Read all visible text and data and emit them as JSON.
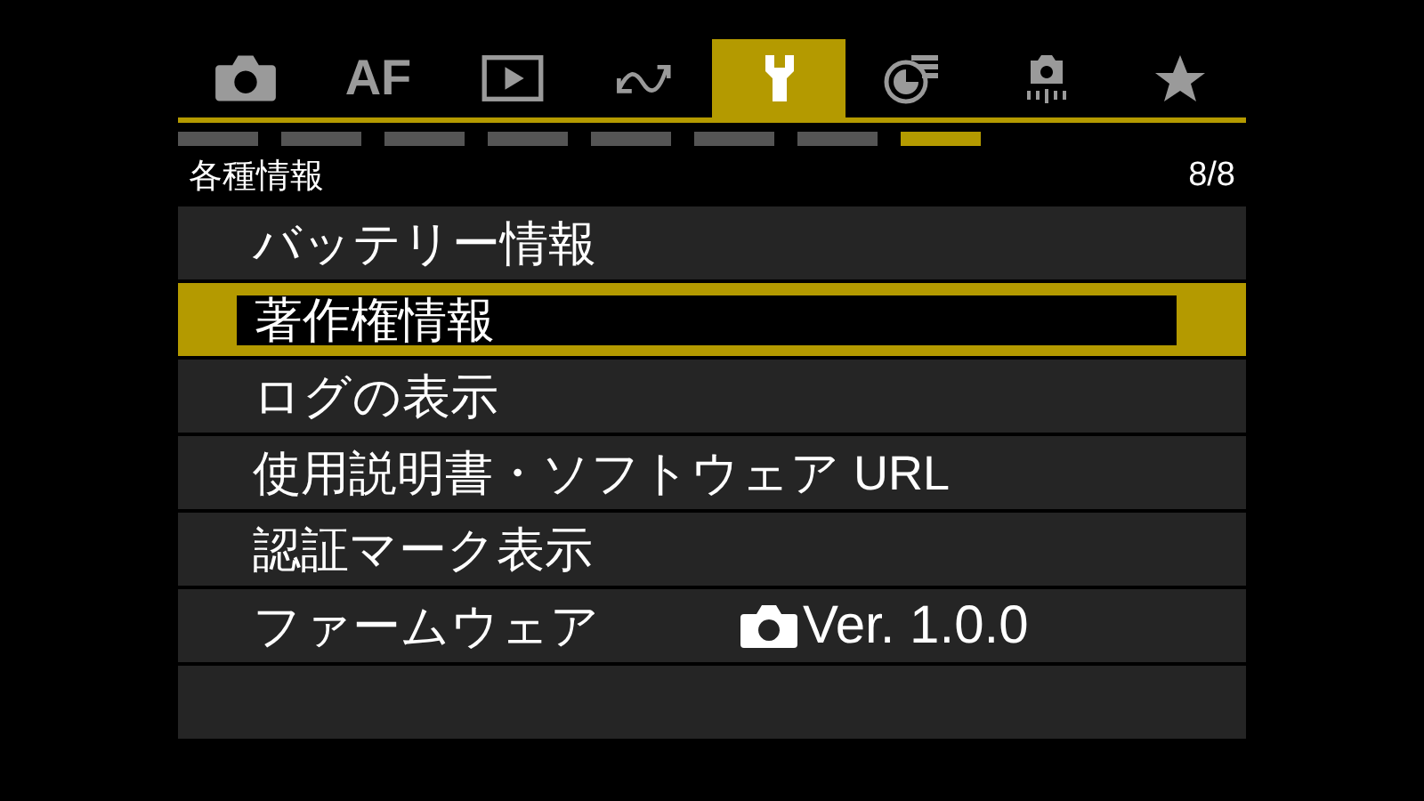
{
  "tabs": [
    {
      "selected": false
    },
    {
      "label": "AF",
      "selected": false
    },
    {
      "selected": false
    },
    {
      "selected": false
    },
    {
      "selected": true
    },
    {
      "selected": false
    },
    {
      "selected": false
    },
    {
      "selected": false
    }
  ],
  "pages": [
    {
      "selected": false
    },
    {
      "selected": false
    },
    {
      "selected": false
    },
    {
      "selected": false
    },
    {
      "selected": false
    },
    {
      "selected": false
    },
    {
      "selected": false
    },
    {
      "selected": true
    }
  ],
  "header": {
    "title": "各種情報",
    "page": "8/8"
  },
  "menu": [
    {
      "label": "バッテリー情報",
      "selected": false
    },
    {
      "label": "著作権情報",
      "selected": true
    },
    {
      "label": "ログの表示",
      "selected": false
    },
    {
      "label": "使用説明書・ソフトウェア URL",
      "selected": false
    },
    {
      "label": "認証マーク表示",
      "selected": false
    },
    {
      "label": "ファームウェア",
      "value": "Ver. 1.0.0",
      "selected": false
    }
  ]
}
